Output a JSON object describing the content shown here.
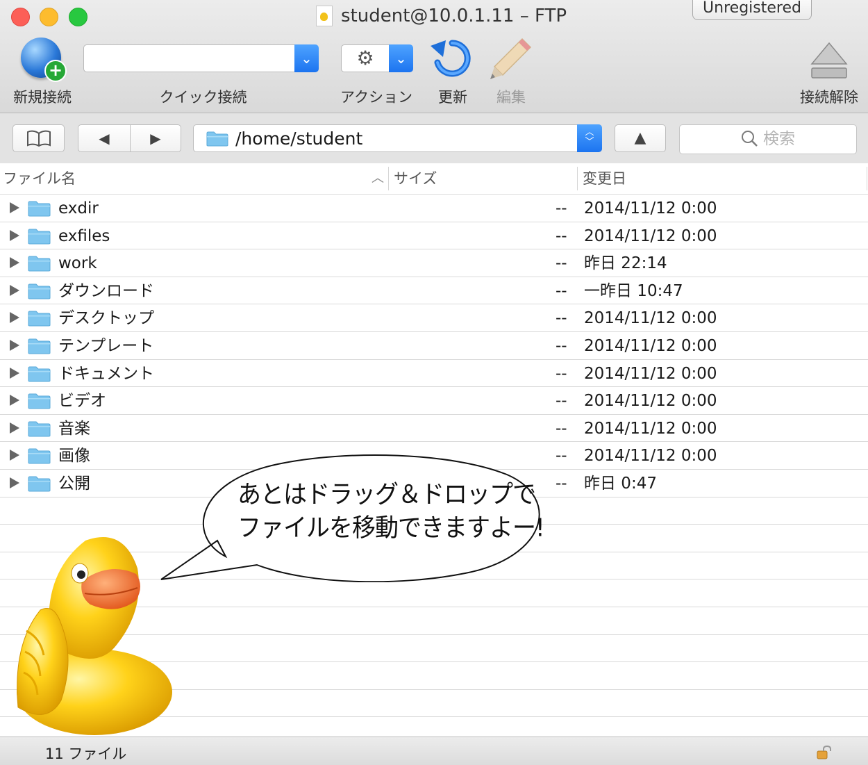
{
  "window": {
    "title": "student@10.0.1.11 – FTP",
    "badge": "Unregistered"
  },
  "toolbar": {
    "new_connection": "新規接続",
    "quick_connect": "クイック接続",
    "quick_connect_value": "",
    "action": "アクション",
    "refresh": "更新",
    "edit": "編集",
    "disconnect": "接続解除"
  },
  "nav": {
    "path": "/home/student",
    "search_placeholder": "検索"
  },
  "columns": {
    "filename": "ファイル名",
    "size": "サイズ",
    "modified": "変更日"
  },
  "files": [
    {
      "name": "exdir",
      "size": "--",
      "date": "2014/11/12 0:00"
    },
    {
      "name": "exfiles",
      "size": "--",
      "date": "2014/11/12 0:00"
    },
    {
      "name": "work",
      "size": "--",
      "date": "昨日 22:14"
    },
    {
      "name": "ダウンロード",
      "size": "--",
      "date": "一昨日 10:47"
    },
    {
      "name": "デスクトップ",
      "size": "--",
      "date": "2014/11/12 0:00"
    },
    {
      "name": "テンプレート",
      "size": "--",
      "date": "2014/11/12 0:00"
    },
    {
      "name": "ドキュメント",
      "size": "--",
      "date": "2014/11/12 0:00"
    },
    {
      "name": "ビデオ",
      "size": "--",
      "date": "2014/11/12 0:00"
    },
    {
      "name": "音楽",
      "size": "--",
      "date": "2014/11/12 0:00"
    },
    {
      "name": "画像",
      "size": "--",
      "date": "2014/11/12 0:00"
    },
    {
      "name": "公開",
      "size": "--",
      "date": "昨日 0:47"
    }
  ],
  "status": {
    "count": "11 ファイル"
  },
  "callout": {
    "line1": "あとはドラッグ＆ドロップで",
    "line2": "ファイルを移動できますよー!"
  },
  "colors": {
    "folder": "#7fc6ef",
    "accent": "#1c74f0"
  }
}
